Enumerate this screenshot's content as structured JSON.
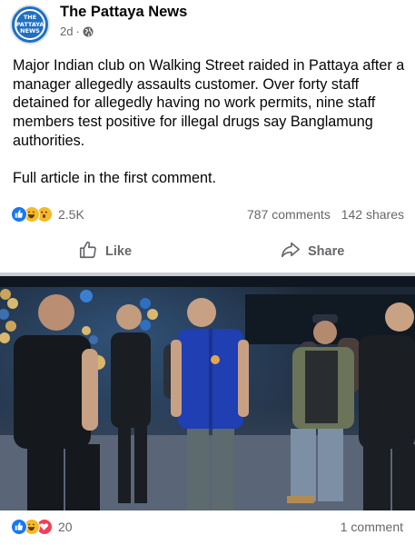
{
  "post": {
    "page_name": "The Pattaya News",
    "avatar_text_line1": "THE",
    "avatar_text_line2": "PATTAYA",
    "avatar_text_line3": "NEWS",
    "time": "2d",
    "separator": "·",
    "privacy_icon": "globe-icon",
    "text_paragraph_1": "Major Indian club on Walking Street raided in Pattaya after a manager allegedly assaults customer. Over forty staff detained for allegedly having no work permits, nine staff members test positive for illegal drugs say Banglamung authorities.",
    "text_paragraph_2": "Full article in the first comment."
  },
  "stats": {
    "reaction_icons": [
      "like-icon",
      "haha-icon",
      "wow-icon"
    ],
    "reaction_count": "2.5K",
    "comments": "787 comments",
    "shares": "142 shares"
  },
  "actions": {
    "like_label": "Like",
    "share_label": "Share"
  },
  "photo_footer": {
    "reaction_icons": [
      "like-icon",
      "haha-icon",
      "love-icon"
    ],
    "reaction_count": "20",
    "comments": "1 comment"
  },
  "colors": {
    "like_blue": "#1877f2",
    "love_red": "#f33e58",
    "haha_yellow": "#f7b928",
    "secondary_text": "#65676b",
    "avatar_blue": "#1f6fc2"
  }
}
